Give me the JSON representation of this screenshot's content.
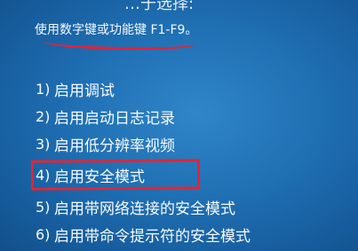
{
  "header": {
    "top_text": "…于选择:",
    "instruction_prefix": "使用数字键或功能键",
    "instruction_keys": "F1-F9。"
  },
  "menu": {
    "items": [
      {
        "number": "1)",
        "label": "启用调试"
      },
      {
        "number": "2)",
        "label": "启用启动日志记录"
      },
      {
        "number": "3)",
        "label": "启用低分辨率视频"
      },
      {
        "number": "4)",
        "label": "启用安全模式"
      },
      {
        "number": "5)",
        "label": "启用带网络连接的安全模式"
      },
      {
        "number": "6)",
        "label": "启用带命令提示符的安全模式"
      }
    ]
  },
  "colors": {
    "background": "#1f6fb3",
    "text": "#f6f9fd",
    "annotation": "#e22535"
  }
}
